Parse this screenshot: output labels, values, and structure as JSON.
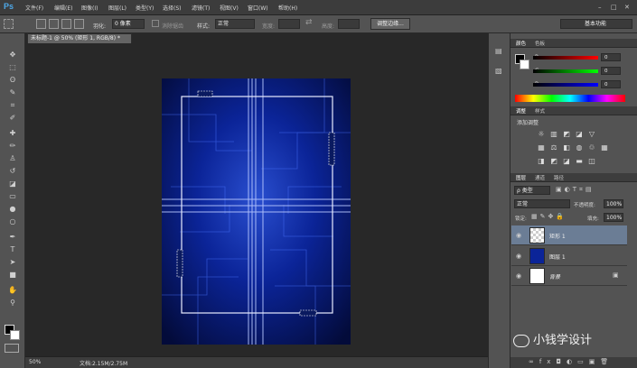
{
  "app": {
    "logo": "Ps",
    "menu": [
      "文件(F)",
      "编辑(E)",
      "图像(I)",
      "图层(L)",
      "类型(Y)",
      "选择(S)",
      "滤镜(T)",
      "视图(V)",
      "窗口(W)",
      "帮助(H)"
    ],
    "window_controls": [
      "–",
      "□",
      "✕"
    ]
  },
  "options": {
    "feather_label": "羽化:",
    "feather_value": "0 像素",
    "antialias_label": "消除锯齿",
    "style_label": "样式:",
    "style_value": "正常",
    "width_label": "宽度:",
    "height_label": "高度:",
    "refine_edge": "调整边缘...",
    "workspace": "基本功能"
  },
  "document": {
    "tab_title": "未标题-1 @ 50% (矩形 1, RGB/8) *",
    "zoom": "50%",
    "doc_info": "文档:2.15M/2.75M"
  },
  "panels": {
    "color": {
      "tabs": [
        "颜色",
        "色板"
      ],
      "channels": [
        {
          "label": "R",
          "value": "0"
        },
        {
          "label": "G",
          "value": "0"
        },
        {
          "label": "B",
          "value": "0"
        }
      ]
    },
    "adjustments": {
      "tabs": [
        "调整",
        "样式"
      ],
      "title": "添加调整"
    },
    "layers": {
      "tabs": [
        "图层",
        "通道",
        "路径"
      ],
      "filter_kind": "ρ 类型",
      "blend_mode": "正常",
      "opacity_label": "不透明度:",
      "opacity_value": "100%",
      "lock_label": "锁定:",
      "fill_label": "填充:",
      "fill_value": "100%",
      "items": [
        {
          "name": "矩形 1"
        },
        {
          "name": "图层 1"
        },
        {
          "name": "背景"
        }
      ]
    }
  },
  "watermark": "小钱学设计",
  "colors": {
    "accent": "#4ea8e8",
    "canvas_blue": "#0a1f7a",
    "selected_layer": "#6b7d95"
  }
}
